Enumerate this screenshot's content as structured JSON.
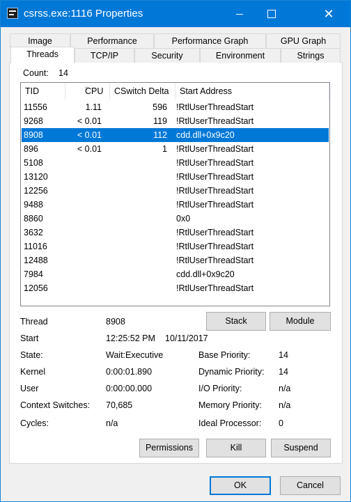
{
  "window": {
    "title": "csrss.exe:1116 Properties",
    "minimize": "—",
    "maximize": "☐",
    "close": "✕"
  },
  "tabs_row1": [
    "Image",
    "Performance",
    "Performance Graph",
    "GPU Graph"
  ],
  "tabs_row2": [
    "Threads",
    "TCP/IP",
    "Security",
    "Environment",
    "Strings"
  ],
  "active_tab": "Threads",
  "count": {
    "label": "Count:",
    "value": "14"
  },
  "columns": [
    "TID",
    "CPU",
    "CSwitch Delta",
    "Start Address"
  ],
  "threads": [
    {
      "tid": "11556",
      "cpu": "1.11",
      "cs": "596",
      "addr": "!RtlUserThreadStart"
    },
    {
      "tid": "9268",
      "cpu": "< 0.01",
      "cs": "119",
      "addr": "!RtlUserThreadStart"
    },
    {
      "tid": "8908",
      "cpu": "< 0.01",
      "cs": "112",
      "addr": "cdd.dll+0x9c20"
    },
    {
      "tid": "896",
      "cpu": "< 0.01",
      "cs": "1",
      "addr": "!RtlUserThreadStart"
    },
    {
      "tid": "5108",
      "cpu": "",
      "cs": "",
      "addr": "!RtlUserThreadStart"
    },
    {
      "tid": "13120",
      "cpu": "",
      "cs": "",
      "addr": "!RtlUserThreadStart"
    },
    {
      "tid": "12256",
      "cpu": "",
      "cs": "",
      "addr": "!RtlUserThreadStart"
    },
    {
      "tid": "9488",
      "cpu": "",
      "cs": "",
      "addr": "!RtlUserThreadStart"
    },
    {
      "tid": "8860",
      "cpu": "",
      "cs": "",
      "addr": "0x0"
    },
    {
      "tid": "3632",
      "cpu": "",
      "cs": "",
      "addr": "!RtlUserThreadStart"
    },
    {
      "tid": "11016",
      "cpu": "",
      "cs": "",
      "addr": "!RtlUserThreadStart"
    },
    {
      "tid": "12488",
      "cpu": "",
      "cs": "",
      "addr": "!RtlUserThreadStart"
    },
    {
      "tid": "7984",
      "cpu": "",
      "cs": "",
      "addr": "cdd.dll+0x9c20"
    },
    {
      "tid": "12056",
      "cpu": "",
      "cs": "",
      "addr": "!RtlUserThreadStart"
    }
  ],
  "selected_row": 2,
  "details": {
    "thread_label": "Thread",
    "thread_value": "8908",
    "start_label": "Start",
    "start_time": "12:25:52 PM",
    "start_date": "10/11/2017",
    "state_label": "State:",
    "state_value": "Wait:Executive",
    "kernel_label": "Kernel",
    "kernel_value": "0:00:01.890",
    "user_label": "User",
    "user_value": "0:00:00.000",
    "cs_label": "Context Switches:",
    "cs_value": "70,685",
    "cycles_label": "Cycles:",
    "cycles_value": "n/a",
    "base_prio_label": "Base Priority:",
    "base_prio_value": "14",
    "dyn_prio_label": "Dynamic Priority:",
    "dyn_prio_value": "14",
    "io_prio_label": "I/O Priority:",
    "io_prio_value": "n/a",
    "mem_prio_label": "Memory Priority:",
    "mem_prio_value": "n/a",
    "ideal_label": "Ideal Processor:",
    "ideal_value": "0"
  },
  "buttons": {
    "stack": "Stack",
    "module": "Module",
    "permissions": "Permissions",
    "kill": "Kill",
    "suspend": "Suspend",
    "ok": "OK",
    "cancel": "Cancel"
  },
  "colors": {
    "titlebar": "#0078d7",
    "selection": "#0078d7"
  }
}
